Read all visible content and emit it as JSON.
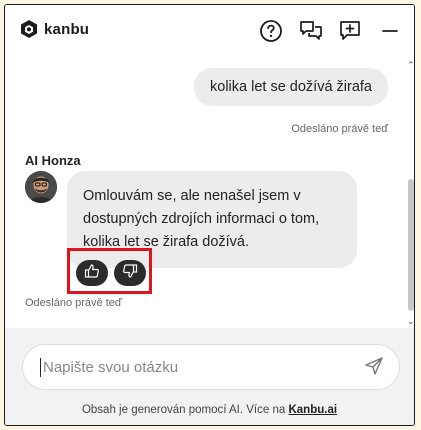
{
  "header": {
    "logo_text": "kanbu",
    "icons": [
      "logo-cube-icon",
      "help-icon",
      "chat-bubbles-icon",
      "new-chat-icon",
      "minimize-icon"
    ]
  },
  "chat": {
    "user_message": "kolika let se dožívá žirafa",
    "user_status": "Odesláno právě teď",
    "agent_name": "AI Honza",
    "agent_message": "Omlouvám se, ale nenašel jsem v dostupných zdrojích informaci o tom, kolika let se žirafa dožívá.",
    "agent_status": "Odesláno právě teď",
    "feedback_icons": [
      "thumbs-up-icon",
      "thumbs-down-icon"
    ]
  },
  "composer": {
    "placeholder": "Napište svou otázku",
    "value": "",
    "send_icon": "send-icon"
  },
  "footer": {
    "disclaimer_prefix": "Obsah je generován pomocí AI. Více na ",
    "disclaimer_link": "Kanbu.ai"
  },
  "colors": {
    "page_background": "#fdf6e3",
    "bubble": "#ececec",
    "feedback_button": "#2b2b2b",
    "highlight": "#e0141e",
    "footer_background": "#f2f2f2"
  }
}
